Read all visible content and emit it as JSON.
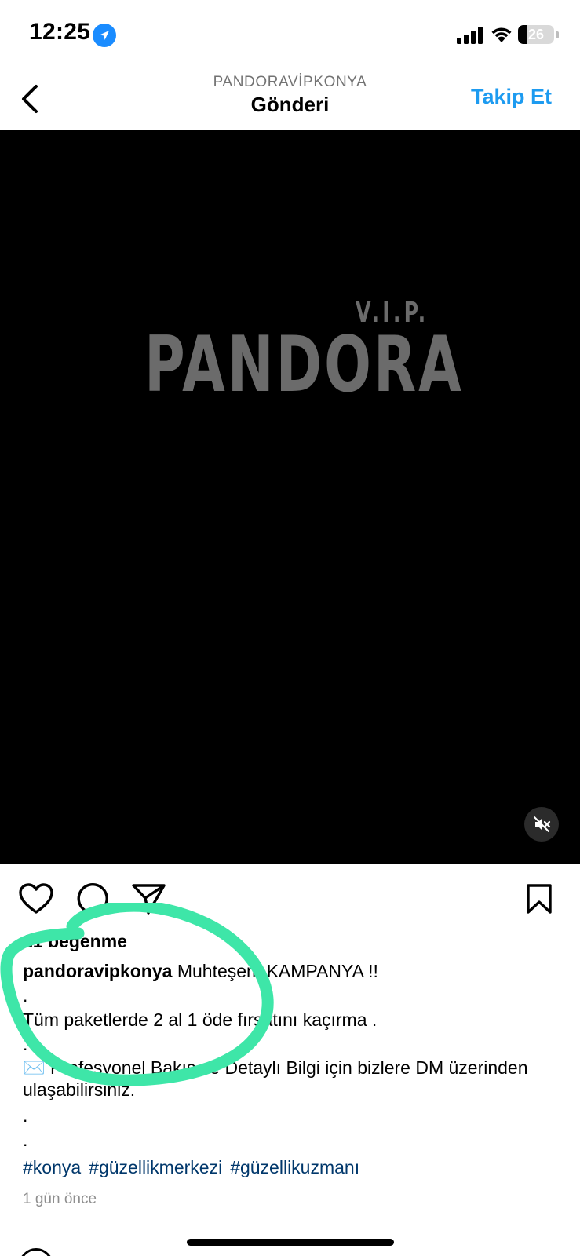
{
  "status_bar": {
    "time": "12:25",
    "battery": "26",
    "battery_level": 0.26,
    "icons": [
      "location-arrow-icon",
      "signal-bars-icon",
      "wifi-icon",
      "battery-icon"
    ]
  },
  "header": {
    "subtitle": "PANDORAVİPKONYA",
    "title": "Gönderi",
    "follow_label": "Takip Et",
    "back_icon": "chevron-left-icon"
  },
  "media": {
    "logo_vip": "V.I.P.",
    "logo_main": "PANDORA",
    "mute_icon": "speaker-muted-icon",
    "background": "#000000",
    "logo_color": "#6b6b6b"
  },
  "actions": {
    "icons": [
      "heart-icon",
      "comment-icon",
      "share-icon",
      "bookmark-icon"
    ]
  },
  "post": {
    "likes": "21 beğenme",
    "username": "pandoravipkonya",
    "caption_first": " Muhteşem KAMPANYA !!",
    "caption_lines": [
      ".",
      "Tüm paketlerde 2 al 1 öde fırsatını kaçırma .",
      ".",
      "✉️ Profesyonel Bakış ve Detaylı Bilgi için bizlere DM üzerinden ulaşabilirsiniz.",
      ".",
      "."
    ],
    "hashtags": [
      "#konya",
      "#güzellikmerkezi",
      "#güzellikuzmanı"
    ],
    "time_ago": "1 gün önce"
  },
  "colors": {
    "accent": "#1d9bf0",
    "hashtag": "#00376b",
    "annotation": "#3ee6a8"
  }
}
